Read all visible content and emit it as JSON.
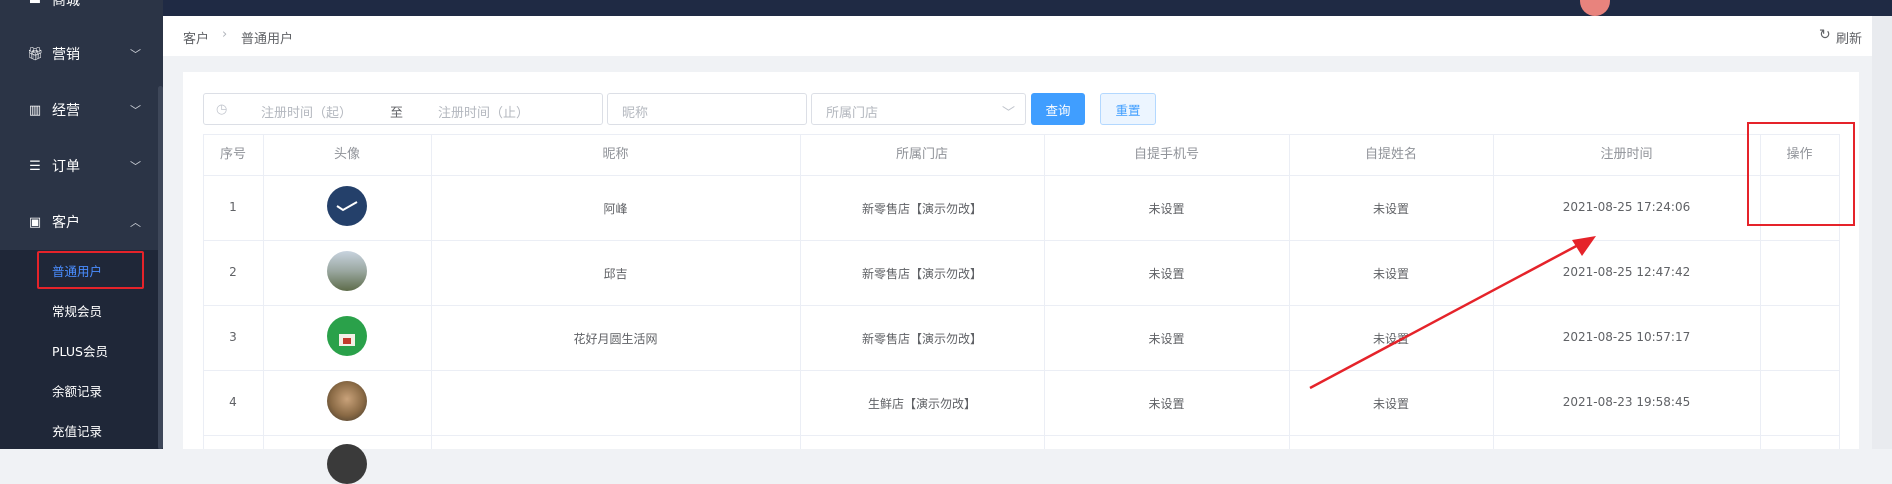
{
  "sidebar": {
    "menu": [
      {
        "label": "商城",
        "icon": "shop-icon"
      },
      {
        "label": "营销",
        "icon": "gift-icon"
      },
      {
        "label": "经营",
        "icon": "bar-chart-icon"
      },
      {
        "label": "订单",
        "icon": "list-icon"
      },
      {
        "label": "客户",
        "icon": "id-card-icon"
      }
    ],
    "submenu": [
      {
        "label": "普通用户",
        "active": true
      },
      {
        "label": "常规会员"
      },
      {
        "label": "PLUS会员"
      },
      {
        "label": "余额记录"
      },
      {
        "label": "充值记录"
      }
    ]
  },
  "breadcrumb": {
    "root": "客户",
    "current": "普通用户"
  },
  "header": {
    "refresh_label": "刷新"
  },
  "filters": {
    "date_start_placeholder": "注册时间（起）",
    "date_separator": "至",
    "date_end_placeholder": "注册时间（止）",
    "nickname_placeholder": "昵称",
    "store_placeholder": "所属门店",
    "query_label": "查询",
    "reset_label": "重置"
  },
  "table": {
    "columns": [
      "序号",
      "头像",
      "昵称",
      "所属门店",
      "自提手机号",
      "自提姓名",
      "注册时间",
      "操作"
    ],
    "rows": [
      {
        "index": "1",
        "avatar": "logo-avatar",
        "nickname": "阿峰",
        "store": "新零售店【演示勿改】",
        "phone": "未设置",
        "name": "未设置",
        "time": "2021-08-25 17:24:06"
      },
      {
        "index": "2",
        "avatar": "landscape-avatar",
        "nickname": "邱吉",
        "store": "新零售店【演示勿改】",
        "phone": "未设置",
        "name": "未设置",
        "time": "2021-08-25 12:47:42"
      },
      {
        "index": "3",
        "avatar": "green-logo-avatar",
        "nickname": "花好月圆生活网",
        "store": "新零售店【演示勿改】",
        "phone": "未设置",
        "name": "未设置",
        "time": "2021-08-25 10:57:17"
      },
      {
        "index": "4",
        "avatar": "face-avatar",
        "nickname": "",
        "store": "生鲜店【演示勿改】",
        "phone": "未设置",
        "name": "未设置",
        "time": "2021-08-23 19:58:45"
      }
    ]
  },
  "colors": {
    "accent": "#409eff",
    "sidebar_bg": "#2b3446",
    "annotation_red": "#e5232a"
  }
}
